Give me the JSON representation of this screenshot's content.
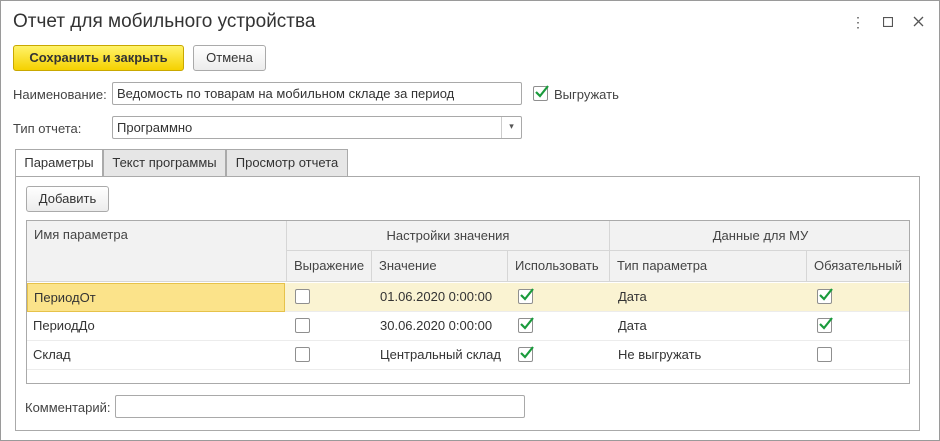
{
  "window": {
    "title": "Отчет для мобильного устройства"
  },
  "toolbar": {
    "save_close_label": "Сохранить и закрыть",
    "cancel_label": "Отмена"
  },
  "form": {
    "name_label": "Наименование:",
    "name_value": "Ведомость по товарам на мобильном складе за период",
    "export_label": "Выгружать",
    "export_checked": true,
    "report_type_label": "Тип отчета:",
    "report_type_value": "Программно",
    "comment_label": "Комментарий:",
    "comment_value": ""
  },
  "tabs": [
    {
      "label": "Параметры",
      "active": true
    },
    {
      "label": "Текст программы",
      "active": false
    },
    {
      "label": "Просмотр отчета",
      "active": false
    }
  ],
  "params": {
    "add_label": "Добавить",
    "headers": {
      "name": "Имя параметра",
      "value_settings": "Настройки значения",
      "mu_data": "Данные для МУ",
      "expression": "Выражение",
      "value": "Значение",
      "use": "Использовать",
      "param_type": "Тип параметра",
      "required": "Обязательный"
    },
    "rows": [
      {
        "name": "ПериодОт",
        "expression": false,
        "value": "01.06.2020 0:00:00",
        "use": true,
        "param_type": "Дата",
        "required": true
      },
      {
        "name": "ПериодДо",
        "expression": false,
        "value": "30.06.2020 0:00:00",
        "use": true,
        "param_type": "Дата",
        "required": true
      },
      {
        "name": "Склад",
        "expression": false,
        "value": "Центральный склад",
        "use": true,
        "param_type": "Не выгружать",
        "required": false
      }
    ]
  },
  "colors": {
    "accent": "#f5d100",
    "check": "#1a9b3c",
    "selected_row": "#faf3d2"
  }
}
